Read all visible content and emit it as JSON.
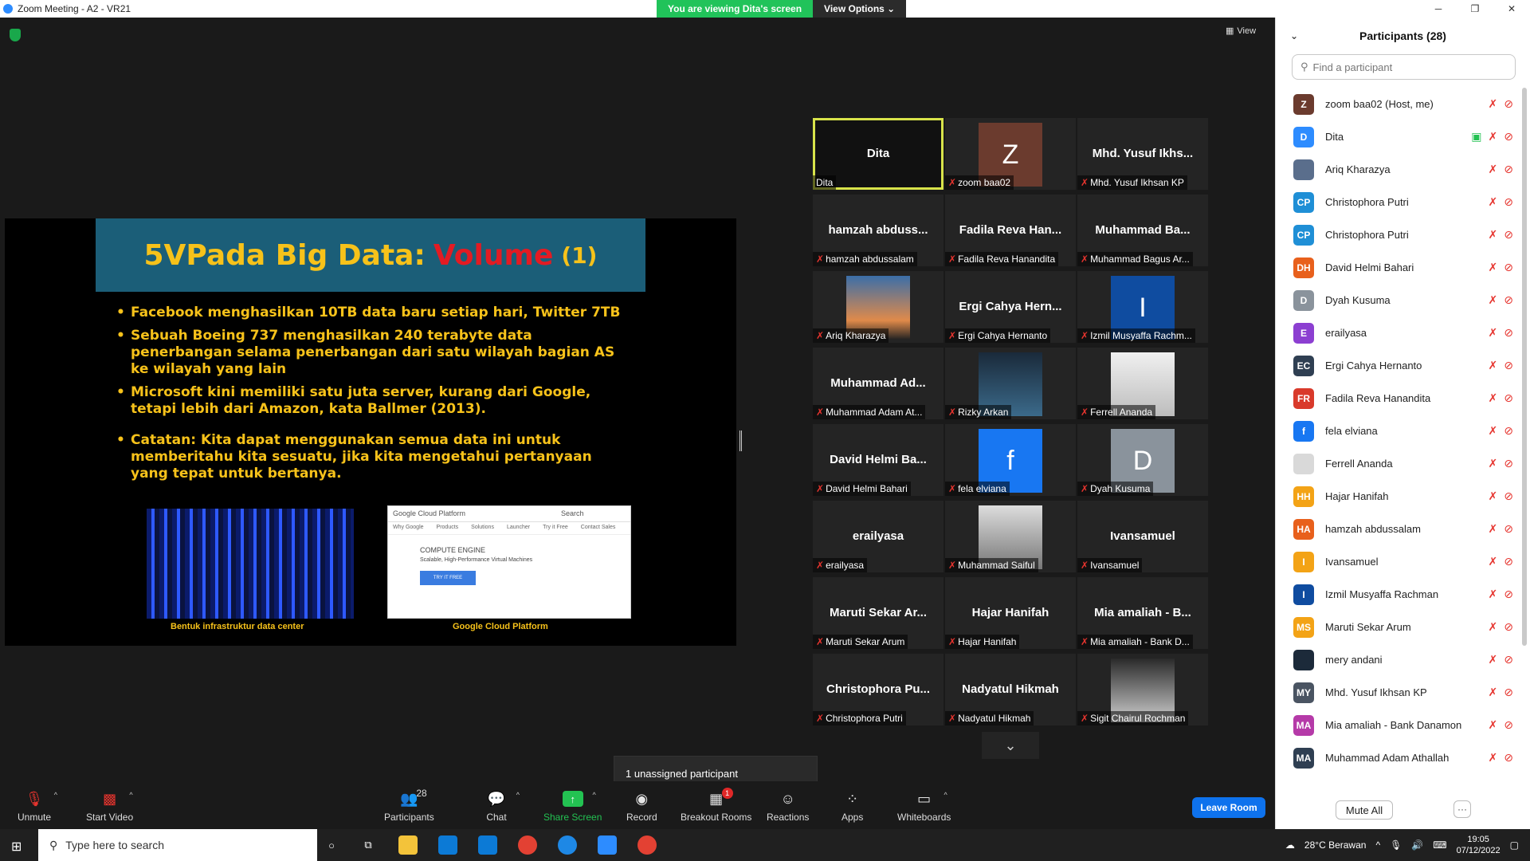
{
  "window": {
    "title": "Zoom Meeting - A2 - VR21"
  },
  "banner": {
    "viewing": "You are viewing Dita's screen",
    "view_options": "View Options ⌄"
  },
  "top_right": {
    "view_label": "View"
  },
  "slide": {
    "title_a": "5VPada Big Data:",
    "title_b": "Volume",
    "title_c": "(1)",
    "bullets": [
      "Facebook menghasilkan 10TB data baru setiap hari, Twitter 7TB",
      "Sebuah Boeing 737 menghasilkan 240 terabyte data penerbangan selama penerbangan dari satu wilayah bagian AS ke wilayah yang lain",
      "Microsoft kini memiliki satu juta server, kurang dari Google, tetapi lebih dari Amazon, kata Ballmer (2013).",
      "Catatan: Kita dapat menggunakan semua data ini untuk memberitahu kita sesuatu, jika kita mengetahui pertanyaan yang tepat untuk bertanya."
    ],
    "caption_left": "Bentuk infrastruktur data center",
    "caption_right": "Google Cloud Platform",
    "gcp": {
      "logo": "Google Cloud Platform",
      "tabs": [
        "Why Google",
        "Products",
        "Solutions",
        "Launcher",
        "Try it Free",
        "Contact Sales"
      ],
      "engine": "COMPUTE ENGINE",
      "sub": "Scalable, High-Performance Virtual Machines",
      "btn": "TRY IT FREE",
      "search": "Search"
    }
  },
  "tiles": [
    {
      "big": "Dita",
      "label": "Dita",
      "active": true,
      "muted": false
    },
    {
      "avatar": "Z",
      "avatar_color": "#6b3b2e",
      "label": "zoom baa02",
      "muted": true
    },
    {
      "big": "Mhd. Yusuf Ikhs...",
      "label": "Mhd. Yusuf Ikhsan KP",
      "muted": true
    },
    {
      "big": "hamzah abduss...",
      "label": "hamzah abdussalam",
      "muted": true
    },
    {
      "big": "Fadila Reva Han...",
      "label": "Fadila Reva Hanandita",
      "muted": true
    },
    {
      "big": "Muhammad Ba...",
      "label": "Muhammad Bagus Ar...",
      "muted": true
    },
    {
      "photo": "sky",
      "label": "Ariq Kharazya",
      "muted": true
    },
    {
      "big": "Ergi Cahya Hern...",
      "label": "Ergi Cahya Hernanto",
      "muted": true
    },
    {
      "avatar": "I",
      "avatar_color": "#0f4ca0",
      "label": "Izmil Musyaffa Rachm...",
      "muted": true
    },
    {
      "big": "Muhammad Ad...",
      "label": "Muhammad Adam At...",
      "muted": true
    },
    {
      "photo": "person",
      "label": "Rizky Arkan",
      "muted": true
    },
    {
      "photo": "cat",
      "label": "Ferrell Ananda",
      "muted": true
    },
    {
      "big": "David Helmi Ba...",
      "label": "David Helmi Bahari",
      "muted": true
    },
    {
      "avatar": "f",
      "avatar_color": "#1877f2",
      "label": "fela elviana",
      "muted": true
    },
    {
      "avatar": "D",
      "avatar_color": "#8a939c",
      "label": "Dyah Kusuma",
      "muted": true
    },
    {
      "big": "erailyasa",
      "label": "erailyasa",
      "muted": true
    },
    {
      "photo": "anime",
      "label": "Muhammad Saiful",
      "muted": true
    },
    {
      "big": "Ivansamuel",
      "label": "Ivansamuel",
      "muted": true
    },
    {
      "big": "Maruti Sekar Ar...",
      "label": "Maruti Sekar Arum",
      "muted": true
    },
    {
      "big": "Hajar Hanifah",
      "label": "Hajar Hanifah",
      "muted": true
    },
    {
      "big": "Mia amaliah - B...",
      "label": "Mia amaliah - Bank D...",
      "muted": true
    },
    {
      "big": "Christophora Pu...",
      "label": "Christophora Putri",
      "muted": true
    },
    {
      "big": "Nadyatul Hikmah",
      "label": "Nadyatul Hikmah",
      "muted": true
    },
    {
      "photo": "sketch",
      "label": "Sigit Chairul Rochman",
      "muted": true
    }
  ],
  "unassigned": "1 unassigned participant",
  "toolbar": {
    "unmute": "Unmute",
    "start_video": "Start Video",
    "participants": "Participants",
    "participants_count": "28",
    "chat": "Chat",
    "share": "Share Screen",
    "record": "Record",
    "breakout": "Breakout Rooms",
    "breakout_badge": "1",
    "reactions": "Reactions",
    "apps": "Apps",
    "whiteboards": "Whiteboards",
    "leave": "Leave Room"
  },
  "panel": {
    "title": "Participants (28)",
    "search_placeholder": "Find a participant",
    "mute_all": "Mute All",
    "participants": [
      {
        "initials": "Z",
        "color": "#6b3b2e",
        "name": "zoom baa02 (Host, me)"
      },
      {
        "initials": "D",
        "color": "#2d8cff",
        "name": "Dita",
        "sharing": true
      },
      {
        "initials": "",
        "color": "#5a6e8c",
        "name": "Ariq Kharazya",
        "photo": true
      },
      {
        "initials": "CP",
        "color": "#1f8fd6",
        "name": "Christophora Putri"
      },
      {
        "initials": "CP",
        "color": "#1f8fd6",
        "name": "Christophora Putri"
      },
      {
        "initials": "DH",
        "color": "#e8601c",
        "name": "David Helmi Bahari"
      },
      {
        "initials": "D",
        "color": "#8a939c",
        "name": "Dyah Kusuma"
      },
      {
        "initials": "E",
        "color": "#8c3fd1",
        "name": "erailyasa"
      },
      {
        "initials": "EC",
        "color": "#2f3f52",
        "name": "Ergi Cahya Hernanto"
      },
      {
        "initials": "FR",
        "color": "#d93a2b",
        "name": "Fadila Reva Hanandita"
      },
      {
        "initials": "f",
        "color": "#1877f2",
        "name": "fela elviana"
      },
      {
        "initials": "",
        "color": "#d9d9d9",
        "name": "Ferrell Ananda",
        "photo": true
      },
      {
        "initials": "HH",
        "color": "#f3a316",
        "name": "Hajar Hanifah"
      },
      {
        "initials": "HA",
        "color": "#e8601c",
        "name": "hamzah abdussalam"
      },
      {
        "initials": "I",
        "color": "#f3a316",
        "name": "Ivansamuel"
      },
      {
        "initials": "I",
        "color": "#0f4ca0",
        "name": "Izmil Musyaffa Rachman"
      },
      {
        "initials": "MS",
        "color": "#f3a316",
        "name": "Maruti Sekar Arum"
      },
      {
        "initials": "",
        "color": "#1c2a3a",
        "name": "mery andani",
        "photo": true
      },
      {
        "initials": "MY",
        "color": "#4a5462",
        "name": "Mhd. Yusuf Ikhsan KP"
      },
      {
        "initials": "MA",
        "color": "#b53aa8",
        "name": "Mia amaliah - Bank Danamon"
      },
      {
        "initials": "MA",
        "color": "#2f3f52",
        "name": "Muhammad Adam Athallah"
      }
    ]
  },
  "taskbar": {
    "search": "Type here to search",
    "weather": "28°C Berawan",
    "time": "19:05",
    "date": "07/12/2022"
  }
}
